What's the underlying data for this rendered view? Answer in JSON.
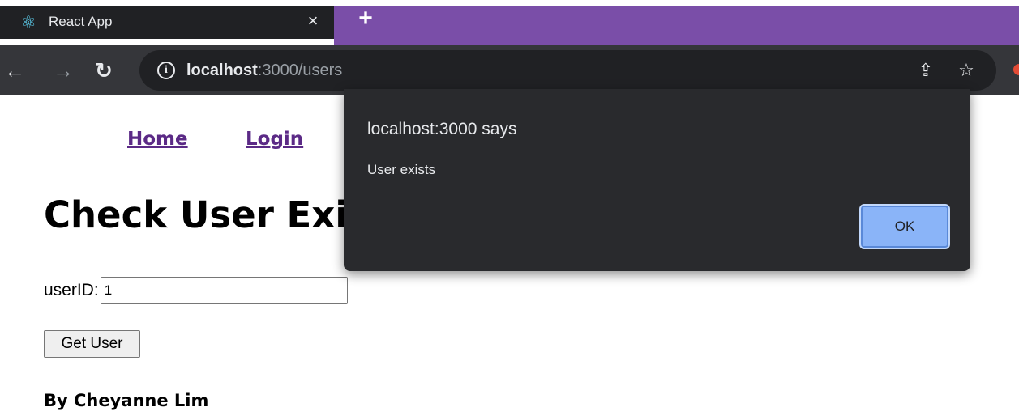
{
  "browser": {
    "tab_title": "React App",
    "tab_favicon": "react-atom-icon",
    "close_glyph": "×",
    "new_tab_glyph": "+",
    "url_host": "localhost",
    "url_rest": ":3000/users",
    "tab_bar_color": "#7a4ea8"
  },
  "nav": {
    "home": "Home",
    "login": "Login"
  },
  "page": {
    "title": "Check User Exists",
    "userid_label": "userID:",
    "userid_value": "1",
    "get_user_button": "Get User",
    "byline": "By Cheyanne Lim"
  },
  "dialog": {
    "title": "localhost:3000 says",
    "message": "User exists",
    "ok_label": "OK",
    "accent": "#8ab4f8"
  }
}
